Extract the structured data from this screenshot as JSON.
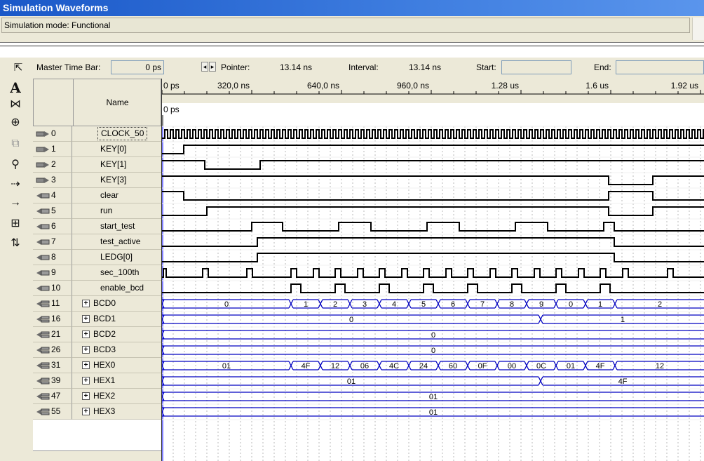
{
  "window": {
    "title": "Simulation Waveforms",
    "mode": "Simulation mode: Functional"
  },
  "toolbar": {
    "master_label": "Master Time Bar:",
    "master_value": "0 ps",
    "pointer_label": "Pointer:",
    "pointer_value": "13.14 ns",
    "interval_label": "Interval:",
    "interval_value": "13.14 ns",
    "start_label": "Start:",
    "start_value": "",
    "end_label": "End:",
    "end_value": ""
  },
  "tools": [
    "pointer-icon",
    "text-icon",
    "waveform-edit-icon",
    "zoom-icon",
    "copy-icon",
    "find-icon",
    "find-next-icon",
    "arrow-right-icon",
    "grid-icon",
    "sort-icon"
  ],
  "header": {
    "name_col": "Name",
    "ruler": [
      "0 ps",
      "320,0 ns",
      "640,0 ns",
      "960,0 ns",
      "1.28 us",
      "1.6 us",
      "1.92 us"
    ],
    "master_marker": "0 ps"
  },
  "signals": [
    {
      "idx": "0",
      "name": "CLOCK_50",
      "type": "in"
    },
    {
      "idx": "1",
      "name": "KEY[0]",
      "type": "in"
    },
    {
      "idx": "2",
      "name": "KEY[1]",
      "type": "in"
    },
    {
      "idx": "3",
      "name": "KEY[3]",
      "type": "in"
    },
    {
      "idx": "4",
      "name": "clear",
      "type": "out"
    },
    {
      "idx": "5",
      "name": "run",
      "type": "out"
    },
    {
      "idx": "6",
      "name": "start_test",
      "type": "out"
    },
    {
      "idx": "7",
      "name": "test_active",
      "type": "out"
    },
    {
      "idx": "8",
      "name": "LEDG[0]",
      "type": "out"
    },
    {
      "idx": "9",
      "name": "sec_100th",
      "type": "out"
    },
    {
      "idx": "10",
      "name": "enable_bcd",
      "type": "out"
    },
    {
      "idx": "11",
      "name": "BCD0",
      "type": "bus"
    },
    {
      "idx": "16",
      "name": "BCD1",
      "type": "bus"
    },
    {
      "idx": "21",
      "name": "BCD2",
      "type": "bus"
    },
    {
      "idx": "26",
      "name": "BCD3",
      "type": "bus"
    },
    {
      "idx": "31",
      "name": "HEX0",
      "type": "bus"
    },
    {
      "idx": "39",
      "name": "HEX1",
      "type": "bus"
    },
    {
      "idx": "47",
      "name": "HEX2",
      "type": "bus"
    },
    {
      "idx": "55",
      "name": "HEX3",
      "type": "bus"
    }
  ],
  "bus_values": {
    "BCD0": [
      "0",
      "1",
      "2",
      "3",
      "4",
      "5",
      "6",
      "7",
      "8",
      "9",
      "0",
      "1",
      "2"
    ],
    "BCD1": [
      "0",
      "1"
    ],
    "BCD2": [
      "0"
    ],
    "BCD3": [
      "0"
    ],
    "HEX0": [
      "01",
      "4F",
      "12",
      "06",
      "4C",
      "24",
      "60",
      "0F",
      "00",
      "0C",
      "01",
      "4F",
      "12"
    ],
    "HEX1": [
      "01",
      "4F"
    ],
    "HEX2": [
      "01"
    ],
    "HEX3": [
      "01"
    ]
  },
  "colors": {
    "wave": "#000000",
    "bus": "#0000c0",
    "grid": "#b8b8b8",
    "accent": "#1a58c8"
  }
}
